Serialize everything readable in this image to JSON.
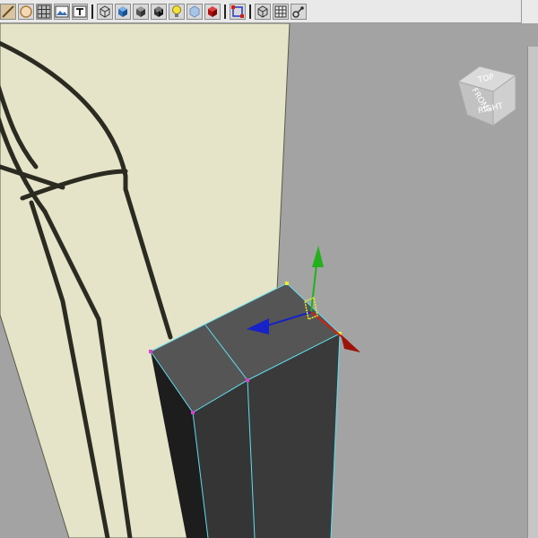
{
  "toolbar": {
    "buttons": [
      {
        "icon": "edge-icon"
      },
      {
        "icon": "sphere-icon"
      },
      {
        "icon": "grid-icon"
      },
      {
        "icon": "image-plane-icon"
      },
      {
        "icon": "text-icon"
      },
      {
        "icon": "wireframe-cube-icon"
      },
      {
        "icon": "shaded-cube-icon"
      },
      {
        "icon": "solid-cube-icon"
      },
      {
        "icon": "textured-cube-icon"
      },
      {
        "icon": "light-bulb-icon"
      },
      {
        "icon": "xray-cube-icon"
      },
      {
        "icon": "red-cube-icon"
      },
      {
        "icon": "isolate-select-icon"
      },
      {
        "icon": "bounding-box-icon"
      },
      {
        "icon": "frame-all-icon"
      },
      {
        "icon": "camera-tool-icon"
      }
    ]
  },
  "viewcube": {
    "top_label": "TOP",
    "right_label": "RIGHT",
    "front_label": "FRONT"
  },
  "colors": {
    "viewport_bg": "#a3a3a3",
    "image_plane": "#e5e4c8",
    "selection_edge": "#5ee0ee",
    "axis_x": "#d21f0f",
    "axis_y": "#22b11d",
    "axis_z": "#1723c6"
  }
}
